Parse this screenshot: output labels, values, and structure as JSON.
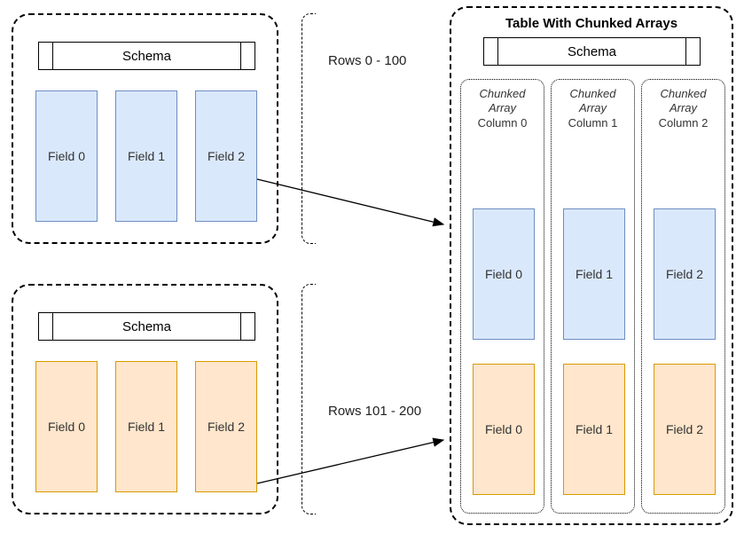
{
  "left_top": {
    "schema_label": "Schema",
    "fields": [
      "Field 0",
      "Field 1",
      "Field 2"
    ]
  },
  "left_bottom": {
    "schema_label": "Schema",
    "fields": [
      "Field 0",
      "Field 1",
      "Field 2"
    ]
  },
  "row_labels": {
    "top": "Rows 0 - 100",
    "bottom": "Rows 101 - 200"
  },
  "right": {
    "title": "Table With Chunked Arrays",
    "schema_label": "Schema",
    "columns": [
      {
        "line1": "Chunked",
        "line2": "Array",
        "line3": "Column 0",
        "blue": "Field 0",
        "orange": "Field 0"
      },
      {
        "line1": "Chunked",
        "line2": "Array",
        "line3": "Column 1",
        "blue": "Field 1",
        "orange": "Field 1"
      },
      {
        "line1": "Chunked",
        "line2": "Array",
        "line3": "Column 2",
        "blue": "Field 2",
        "orange": "Field 2"
      }
    ]
  },
  "chart_data": {
    "type": "diagram",
    "description": "Two record batches (rows 0-100 and 101-200), each with a Schema and Field 0/1/2, combine into a Table With Chunked Arrays where each column is a ChunkedArray containing the corresponding field chunk from each batch.",
    "record_batches": [
      {
        "rows": "0 - 100",
        "fields": [
          "Field 0",
          "Field 1",
          "Field 2"
        ],
        "color": "#dae8fc"
      },
      {
        "rows": "101 - 200",
        "fields": [
          "Field 0",
          "Field 1",
          "Field 2"
        ],
        "color": "#ffe6cc"
      }
    ],
    "table": {
      "title": "Table With Chunked Arrays",
      "columns": [
        {
          "name": "Column 0",
          "kind": "Chunked Array",
          "chunks": [
            "Field 0",
            "Field 0"
          ]
        },
        {
          "name": "Column 1",
          "kind": "Chunked Array",
          "chunks": [
            "Field 1",
            "Field 1"
          ]
        },
        {
          "name": "Column 2",
          "kind": "Chunked Array",
          "chunks": [
            "Field 2",
            "Field 2"
          ]
        }
      ]
    }
  }
}
